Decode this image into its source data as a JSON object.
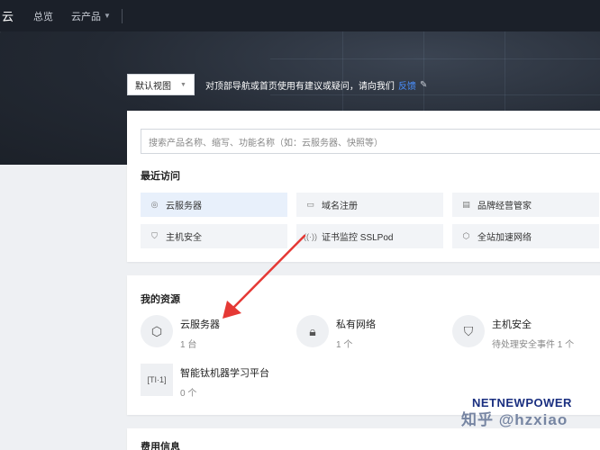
{
  "topnav": {
    "logo": "云",
    "overview": "总览",
    "products": "云产品"
  },
  "viewbar": {
    "view_label": "默认视图",
    "hint": "对顶部导航或首页使用有建议或疑问，请向我们",
    "feedback_link": "反馈"
  },
  "search": {
    "placeholder": "搜索产品名称、缩写、功能名称（如：云服务器、快照等）"
  },
  "recent": {
    "title": "最近访问",
    "items": [
      {
        "label": "云服务器",
        "icon": "server-icon"
      },
      {
        "label": "域名注册",
        "icon": "domain-icon"
      },
      {
        "label": "品牌经营管家",
        "icon": "brand-icon"
      },
      {
        "label": "主机安全",
        "icon": "shield-icon"
      },
      {
        "label": "证书监控 SSLPod",
        "icon": "signal-icon"
      },
      {
        "label": "全站加速网络",
        "icon": "accelerate-icon"
      }
    ]
  },
  "resources": {
    "title": "我的资源",
    "items": [
      {
        "name": "云服务器",
        "count": "1 台",
        "icon": "cube-icon"
      },
      {
        "name": "私有网络",
        "count": "1 个",
        "icon": "lock-icon"
      },
      {
        "name": "主机安全",
        "count": "待处理安全事件 1 个",
        "icon": "shield-icon"
      },
      {
        "name": "智能钛机器学习平台",
        "count": "0 个",
        "icon": "ti-ml-icon"
      }
    ]
  },
  "fees": {
    "title": "费用信息"
  },
  "watermark": {
    "brand": "NETNEWPOWER",
    "text": "知乎 @hzxiao"
  },
  "colors": {
    "nav_bg": "#1b2029",
    "link": "#4a90ff",
    "arrow": "#e53935"
  }
}
